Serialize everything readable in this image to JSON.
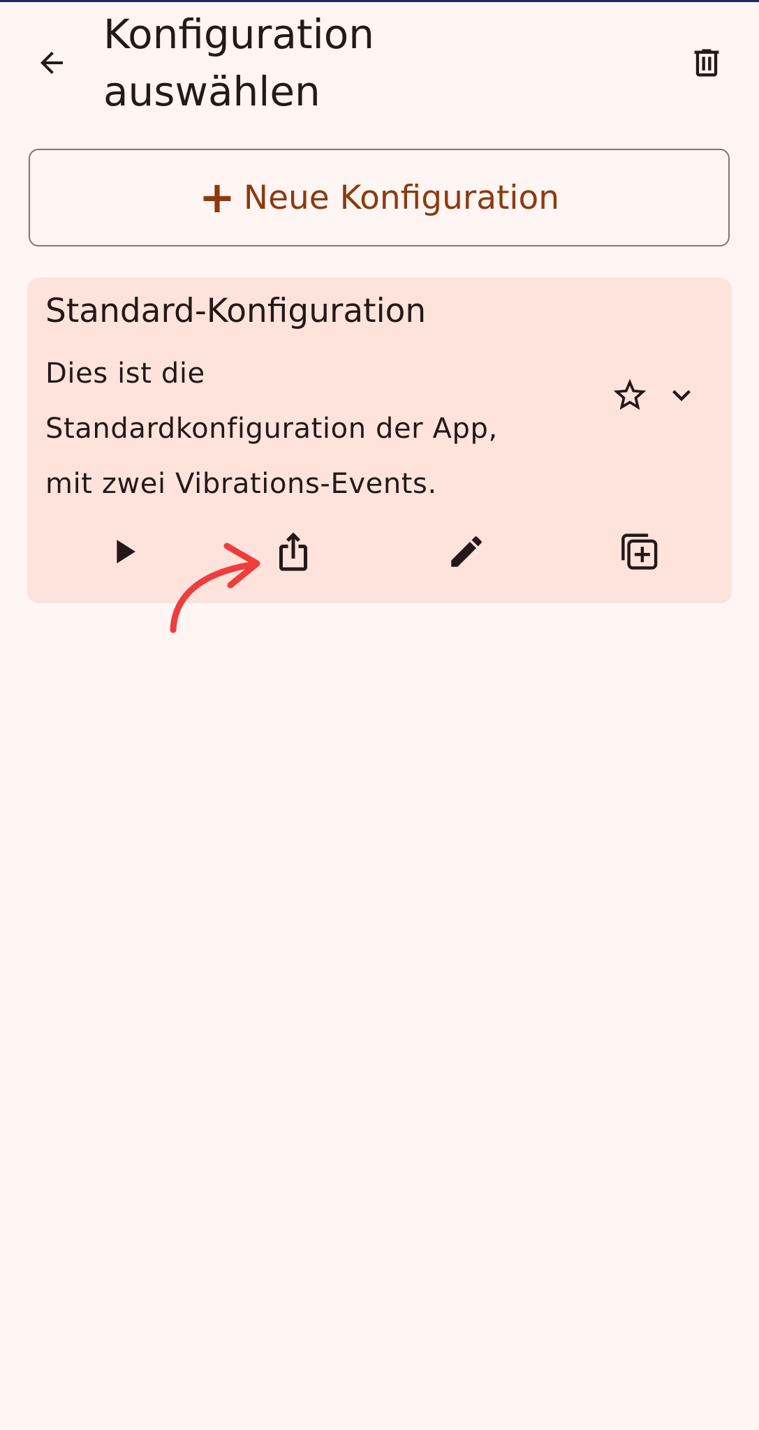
{
  "header": {
    "title_line1": "Konfiguration",
    "title_line2": "auswählen",
    "back_icon": "arrow-left-icon",
    "delete_icon": "trash-icon"
  },
  "new_config_button": {
    "plus": "+",
    "label": "Neue Konfiguration"
  },
  "config_card": {
    "title": "Standard-Konfiguration",
    "description_lines": [
      "Dies ist die",
      "Standardkonfiguration der App,",
      "mit zwei Vibrations-Events."
    ],
    "actions": [
      "play-icon",
      "share-icon",
      "edit-icon",
      "duplicate-icon"
    ],
    "favorite_icon": "star-outline-icon",
    "expand_icon": "chevron-down-icon"
  },
  "colors": {
    "background": "#fff5f2",
    "card": "#fde3db",
    "accent": "#8b3a0f",
    "annotation": "#f03c3c"
  }
}
